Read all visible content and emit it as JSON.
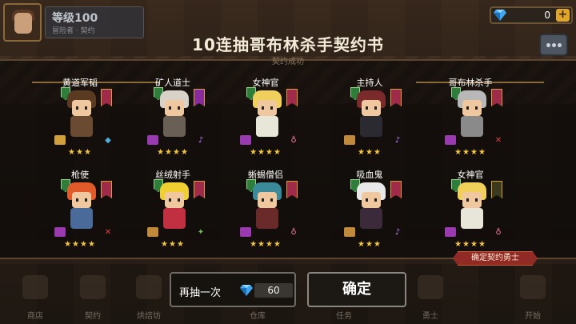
{
  "player": {
    "level_label": "等级100",
    "sub_label": "冒险者 · 契约"
  },
  "currency": {
    "value": "0",
    "plus": "+",
    "color": "#e1a52a"
  },
  "modal": {
    "title": "10连抽哥布林杀手契约书",
    "subtitle": "契约成功"
  },
  "heroes": [
    {
      "name": "黄道军韬",
      "stars": "★★★",
      "hair": "#5b3a22",
      "body": "#6b4a32",
      "banner": "#a02a4a",
      "weapon": "#d1a03a",
      "skill": "◆",
      "skill_color": "#4fb0e0"
    },
    {
      "name": "矿人道士",
      "stars": "★★★★",
      "hair": "#d8d2c8",
      "body": "#6a5f55",
      "banner": "#8a2aa0",
      "weapon": "#9a3ab0",
      "skill": "♪",
      "skill_color": "#c080ff"
    },
    {
      "name": "女神官",
      "stars": "★★★★",
      "hair": "#f0cf5a",
      "body": "#e8e6d8",
      "banner": "#a02a4a",
      "weapon": "#9a3ab0",
      "skill": "♁",
      "skill_color": "#f07aa0"
    },
    {
      "name": "主持人",
      "stars": "★★★",
      "hair": "#7a2a2a",
      "body": "#2a2a30",
      "banner": "#a02a4a",
      "weapon": "#c08a3a",
      "skill": "♪",
      "skill_color": "#c080ff"
    },
    {
      "name": "哥布林杀手",
      "stars": "★★★★",
      "hair": "#b8b8b8",
      "body": "#8a8a8a",
      "banner": "#a02a4a",
      "weapon": "#9a3ab0",
      "skill": "✕",
      "skill_color": "#e04040"
    },
    {
      "name": "枪使",
      "stars": "★★★★",
      "hair": "#e05a2a",
      "body": "#4a6a9a",
      "banner": "#a02a4a",
      "weapon": "#9a3ab0",
      "skill": "✕",
      "skill_color": "#e04040"
    },
    {
      "name": "丝绒射手",
      "stars": "★★★",
      "hair": "#f0d030",
      "body": "#c03040",
      "banner": "#a02a4a",
      "weapon": "#c08a3a",
      "skill": "✦",
      "skill_color": "#70c050"
    },
    {
      "name": "蜥蜴僧侣",
      "stars": "★★★★",
      "hair": "#3a8a9a",
      "body": "#6a2a2a",
      "banner": "#a02a4a",
      "weapon": "#9a3ab0",
      "skill": "♁",
      "skill_color": "#f07aa0"
    },
    {
      "name": "吸血鬼",
      "stars": "★★★",
      "hair": "#e8e8e8",
      "body": "#3a2a3a",
      "banner": "#a02a4a",
      "weapon": "#c08a3a",
      "skill": "♪",
      "skill_color": "#c080ff"
    },
    {
      "name": "女神官",
      "stars": "★★★★",
      "hair": "#f0cf5a",
      "body": "#e8e6d8",
      "banner": "#3a3a20",
      "weapon": "#9a3ab0",
      "skill": "♁",
      "skill_color": "#f07aa0"
    }
  ],
  "confirm_tag": "确定契约勇士",
  "actions": {
    "again_label": "再抽一次",
    "again_cost": "60",
    "ok_label": "确定"
  },
  "nav": [
    "商店",
    "契约",
    "烘焙坊",
    "仓库",
    "任务",
    "勇士",
    "开始"
  ],
  "icons": {
    "gem": "gem-icon",
    "chat": "chat-icon",
    "plus": "plus-icon"
  }
}
